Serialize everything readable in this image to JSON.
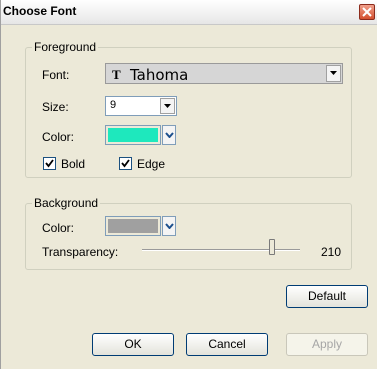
{
  "window": {
    "title": "Choose Font"
  },
  "foreground": {
    "legend": "Foreground",
    "font_label": "Font:",
    "font_icon": "T",
    "font_value": "Tahoma",
    "size_label": "Size:",
    "size_value": "9",
    "color_label": "Color:",
    "color_value": "#1ee8bd",
    "bold_label": "Bold",
    "bold_checked": true,
    "edge_label": "Edge",
    "edge_checked": true
  },
  "background": {
    "legend": "Background",
    "color_label": "Color:",
    "color_value": "#a0a0a0",
    "transparency_label": "Transparency:",
    "transparency_value": "210",
    "transparency_max": 255
  },
  "buttons": {
    "default": "Default",
    "ok": "OK",
    "cancel": "Cancel",
    "apply": "Apply",
    "apply_enabled": false
  }
}
